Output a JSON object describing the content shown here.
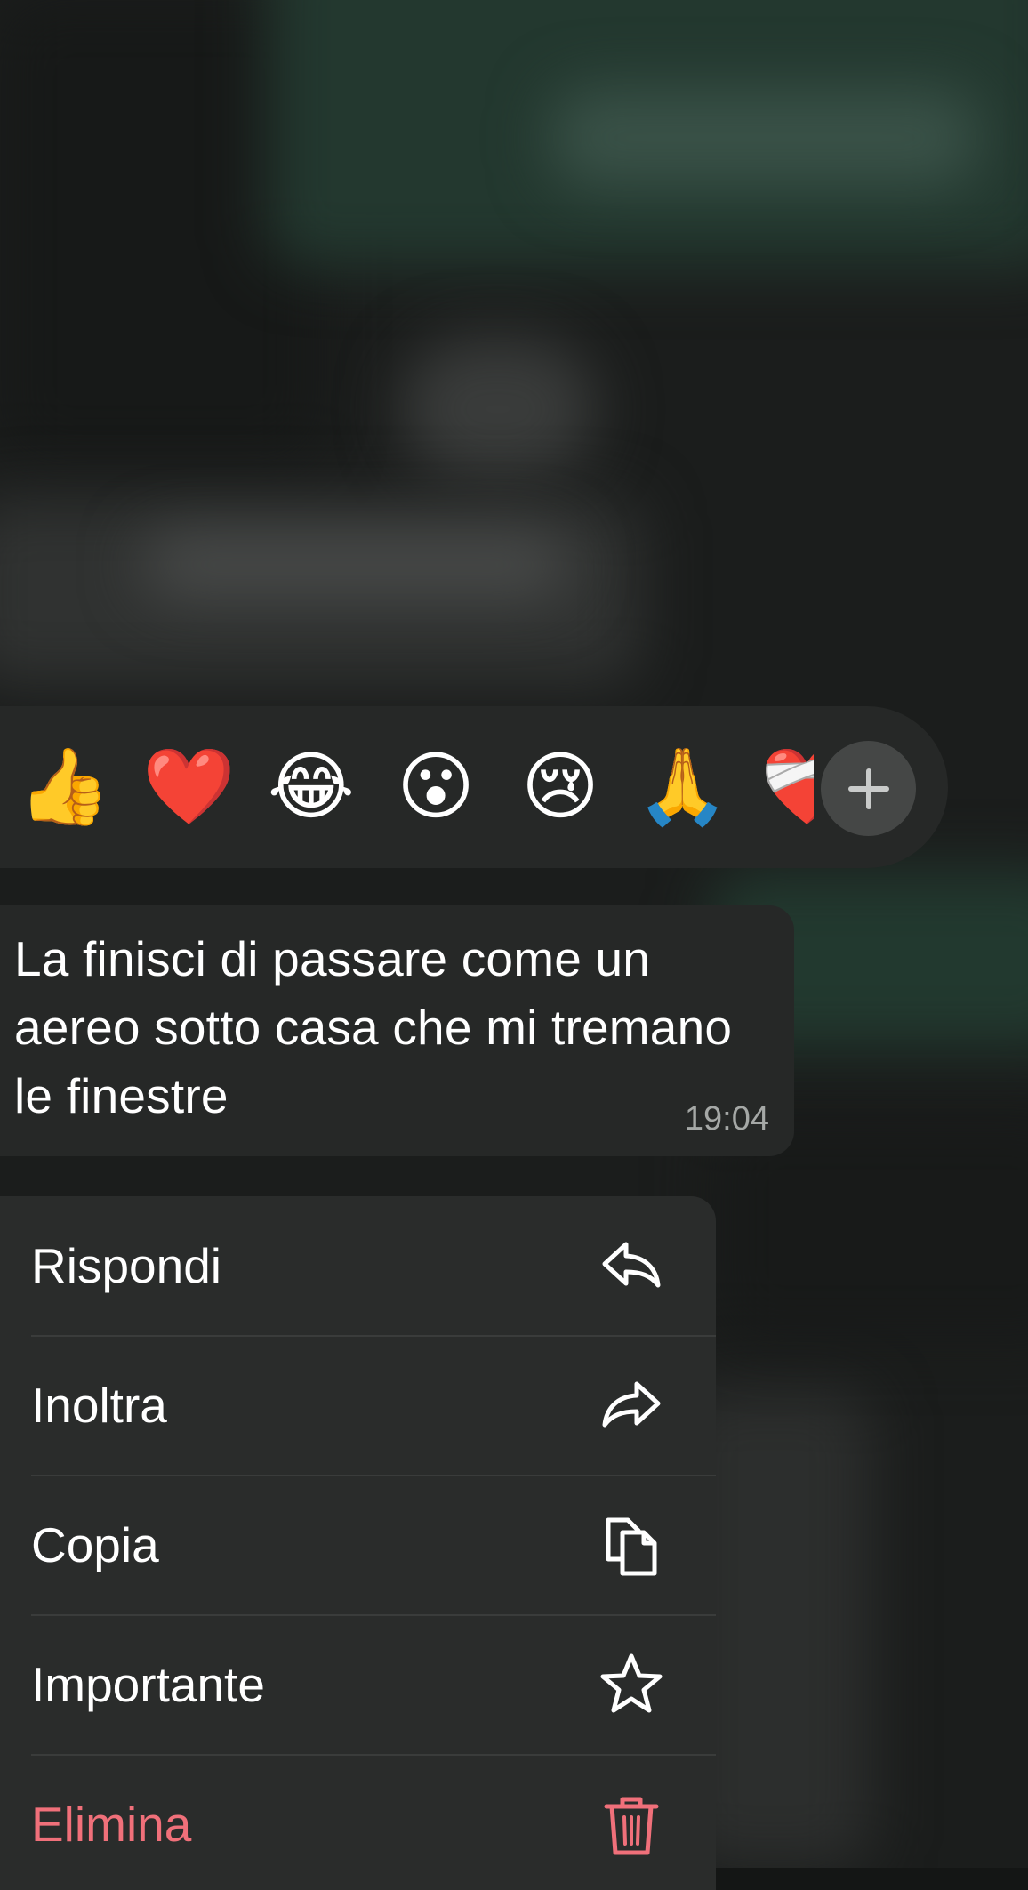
{
  "reactions": {
    "emojis": [
      "👍",
      "❤️",
      "😂",
      "😮",
      "😢",
      "🙏",
      "❤️‍🩹"
    ],
    "add_icon": "plus-icon"
  },
  "message": {
    "text": "La finisci di passare come un aereo sotto casa che mi tremano le finestre",
    "time": "19:04"
  },
  "menu": {
    "items": [
      {
        "label": "Rispondi",
        "icon": "reply-icon"
      },
      {
        "label": "Inoltra",
        "icon": "forward-icon"
      },
      {
        "label": "Copia",
        "icon": "copy-icon"
      },
      {
        "label": "Importante",
        "icon": "star-icon"
      },
      {
        "label": "Elimina",
        "icon": "trash-icon"
      }
    ]
  },
  "colors": {
    "danger": "#f0707a",
    "surface": "#2a2c2b",
    "bubble": "#262827"
  }
}
